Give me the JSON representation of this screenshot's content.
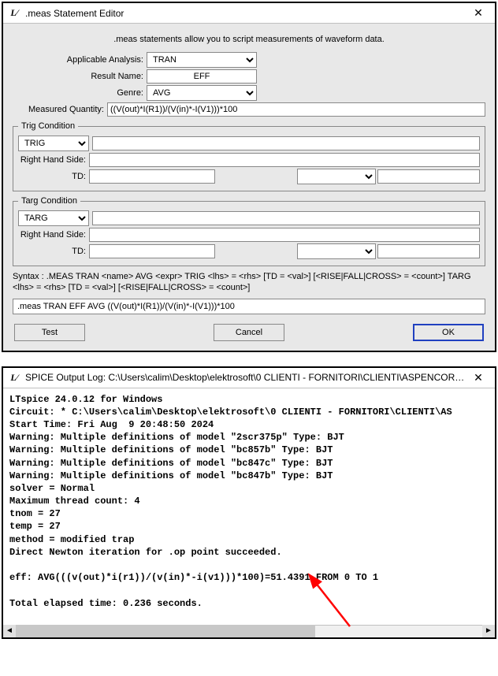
{
  "editor": {
    "title": ".meas Statement Editor",
    "intro": ".meas statements allow you to script measurements of waveform data.",
    "labels": {
      "analysis": "Applicable Analysis:",
      "result_name": "Result Name:",
      "genre": "Genre:",
      "measured": "Measured Quantity:",
      "rhs": "Right Hand Side:",
      "td": "TD:",
      "trig_legend": "Trig Condition",
      "targ_legend": "Targ Condition"
    },
    "values": {
      "analysis": "TRAN",
      "result_name": "EFF",
      "genre": "AVG",
      "measured": "((V(out)*I(R1))/(V(in)*-I(V1)))*100",
      "trig_mode": "TRIG",
      "trig_value": "",
      "trig_rhs": "",
      "trig_td": "",
      "trig_kind": "",
      "trig_count": "",
      "targ_mode": "TARG",
      "targ_value": "",
      "targ_rhs": "",
      "targ_td": "",
      "targ_kind": "",
      "targ_count": ""
    },
    "syntax": "Syntax : .MEAS TRAN <name> AVG <expr> TRIG <lhs> = <rhs> [TD = <val>] [<RISE|FALL|CROSS> = <count>] TARG <lhs> = <rhs> [TD = <val>] [<RISE|FALL|CROSS> = <count>]",
    "result_line": ".meas TRAN EFF AVG ((V(out)*I(R1))/(V(in)*-I(V1)))*100",
    "buttons": {
      "test": "Test",
      "cancel": "Cancel",
      "ok": "OK"
    }
  },
  "log": {
    "title": "SPICE Output Log: C:\\Users\\calim\\Desktop\\elektrosoft\\0 CLIENTI - FORNITORI\\CLIENTI\\ASPENCORE\\arti…",
    "console": "LTspice 24.0.12 for Windows\nCircuit: * C:\\Users\\calim\\Desktop\\elektrosoft\\0 CLIENTI - FORNITORI\\CLIENTI\\AS\nStart Time: Fri Aug  9 20:48:50 2024\nWarning: Multiple definitions of model \"2scr375p\" Type: BJT\nWarning: Multiple definitions of model \"bc857b\" Type: BJT\nWarning: Multiple definitions of model \"bc847c\" Type: BJT\nWarning: Multiple definitions of model \"bc847b\" Type: BJT\nsolver = Normal\nMaximum thread count: 4\ntnom = 27\ntemp = 27\nmethod = modified trap\nDirect Newton iteration for .op point succeeded.\n\neff: AVG(((v(out)*i(r1))/(v(in)*-i(v1)))*100)=51.4391 FROM 0 TO 1\n\nTotal elapsed time: 0.236 seconds.\n"
  }
}
